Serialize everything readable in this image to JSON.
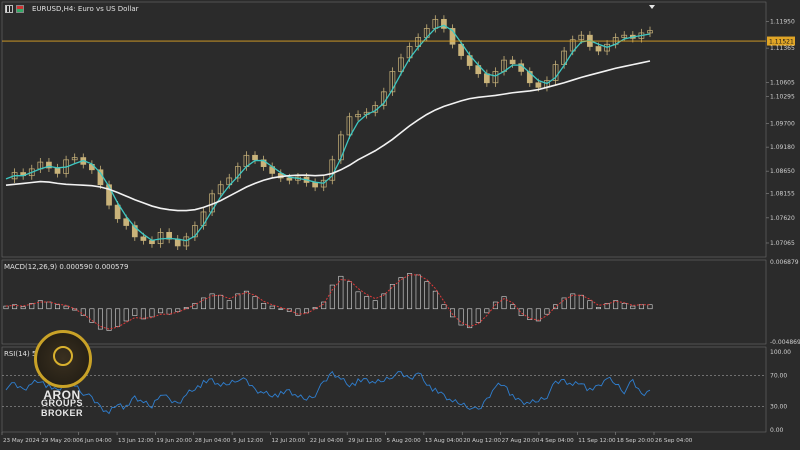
{
  "header": {
    "symbol_title": "EURUSD,H4: Euro vs US Dollar",
    "macd_title": "MACD(12,26,9) 0.000590 0.000579",
    "rsi_title": "RSI(14) 51.30"
  },
  "brand": {
    "line1": "ARON",
    "line2": "GROUPS",
    "line3": "BROKER"
  },
  "colors": {
    "background": "#2b2b2b",
    "candle": "#c9b37a",
    "fast_ma": "#3ec7c2",
    "slow_ma": "#f2f2f2",
    "price_line": "#e0a526",
    "macd_hist": "#d9d9d9",
    "macd_signal": "#e03a3a",
    "rsi_line": "#2f7fd0"
  },
  "chart_data": [
    {
      "type": "line",
      "title": "EURUSD,H4: Euro vs US Dollar",
      "current_price_label": "1.11521",
      "yticks": [
        "1.11950",
        "1.11365",
        "1.10605",
        "1.10295",
        "1.09700",
        "1.09180",
        "1.08650",
        "1.08155",
        "1.07620",
        "1.07065"
      ],
      "ylim": [
        1.068,
        1.1225
      ],
      "current_price": 1.11521,
      "xticks": [
        "23 May 2024",
        "29 May 20:00",
        "6 Jun 04:00",
        "13 Jun 12:00",
        "19 Jun 20:00",
        "28 Jun 04:00",
        "5 Jul 12:00",
        "12 Jul 20:00",
        "22 Jul 04:00",
        "29 Jul 12:00",
        "5 Aug 20:00",
        "13 Aug 04:00",
        "20 Aug 12:00",
        "27 Aug 20:00",
        "4 Sep 04:00",
        "11 Sep 12:00",
        "18 Sep 20:00",
        "26 Sep 04:00"
      ],
      "series": [
        {
          "values": [
            1.0848,
            1.0862,
            1.0855,
            1.087,
            1.0885,
            1.0872,
            1.086,
            1.089,
            1.0895,
            1.088,
            1.0868,
            1.0835,
            1.079,
            1.076,
            1.0745,
            1.072,
            1.0712,
            1.0705,
            1.073,
            1.0715,
            1.07,
            1.072,
            1.0745,
            1.0775,
            1.0815,
            1.0835,
            1.085,
            1.0875,
            1.09,
            1.089,
            1.0875,
            1.086,
            1.085,
            1.0845,
            1.0852,
            1.084,
            1.083,
            1.0845,
            1.089,
            1.0945,
            1.0985,
            1.099,
            1.0995,
            1.101,
            1.104,
            1.1085,
            1.1115,
            1.114,
            1.116,
            1.118,
            1.12,
            1.118,
            1.1145,
            1.112,
            1.1098,
            1.108,
            1.106,
            1.1085,
            1.111,
            1.1102,
            1.1085,
            1.106,
            1.105,
            1.1065,
            1.11,
            1.113,
            1.1155,
            1.1165,
            1.114,
            1.113,
            1.1145,
            1.116,
            1.1165,
            1.1158,
            1.117,
            1.1175
          ]
        },
        {
          "values": [
            1.0834,
            1.0836,
            1.0838,
            1.084,
            1.0842,
            1.0841,
            1.0838,
            1.0836,
            1.0835,
            1.0834,
            1.0833,
            1.083,
            1.0825,
            1.0818,
            1.081,
            1.0802,
            1.0795,
            1.0788,
            1.0783,
            1.078,
            1.0778,
            1.0778,
            1.078,
            1.0785,
            1.0792,
            1.08,
            1.081,
            1.082,
            1.083,
            1.0838,
            1.0845,
            1.085,
            1.0853,
            1.0855,
            1.0856,
            1.0856,
            1.0855,
            1.0856,
            1.086,
            1.0868,
            1.0878,
            1.089,
            1.09,
            1.091,
            1.0922,
            1.0935,
            1.095,
            1.0965,
            1.0978,
            1.099,
            1.1,
            1.1008,
            1.1014,
            1.102,
            1.1025,
            1.1028,
            1.103,
            1.1032,
            1.1035,
            1.1038,
            1.104,
            1.1042,
            1.1045,
            1.105,
            1.1055,
            1.106,
            1.1066,
            1.1072,
            1.1077,
            1.1082,
            1.1087,
            1.1092,
            1.1096,
            1.11,
            1.1104,
            1.1108
          ]
        }
      ]
    },
    {
      "type": "bar",
      "title": "MACD(12,26,9) 0.000590 0.000579",
      "yticks": [
        "0.006879",
        "-0.004869"
      ],
      "ylim": [
        -0.0049,
        0.0069
      ],
      "series": [
        {
          "values": [
            0.0004,
            0.0006,
            0.0003,
            0.0008,
            0.0012,
            0.001,
            0.0006,
            0.0004,
            -0.0002,
            -0.001,
            -0.002,
            -0.003,
            -0.0032,
            -0.0026,
            -0.0018,
            -0.001,
            -0.0015,
            -0.0012,
            -0.0006,
            -0.0008,
            -0.0004,
            0.0002,
            0.0008,
            0.0016,
            0.0022,
            0.002,
            0.0012,
            0.0022,
            0.0026,
            0.0018,
            0.0008,
            0.0004,
            0.0,
            -0.0004,
            -0.001,
            -0.0006,
            0.0002,
            0.001,
            0.0035,
            0.0048,
            0.004,
            0.0025,
            0.0018,
            0.0012,
            0.0022,
            0.0036,
            0.0046,
            0.0052,
            0.005,
            0.004,
            0.0026,
            0.0006,
            -0.0012,
            -0.0024,
            -0.0028,
            -0.002,
            -0.0006,
            0.001,
            0.0018,
            0.0006,
            -0.001,
            -0.0016,
            -0.0018,
            -0.0008,
            0.0006,
            0.0016,
            0.0022,
            0.002,
            0.0012,
            0.0002,
            0.0008,
            0.0012,
            0.0008,
            0.0004,
            0.0006,
            0.0006
          ]
        },
        {
          "values": [
            0.0004,
            0.0005,
            0.0004,
            0.0007,
            0.001,
            0.001,
            0.0007,
            0.0005,
            0.0,
            -0.0008,
            -0.0017,
            -0.0026,
            -0.003,
            -0.0027,
            -0.002,
            -0.0013,
            -0.0014,
            -0.0013,
            -0.0008,
            -0.0008,
            -0.0005,
            0.0,
            0.0006,
            0.0013,
            0.0019,
            0.002,
            0.0015,
            0.002,
            0.0024,
            0.002,
            0.0011,
            0.0006,
            0.0002,
            -0.0002,
            -0.0008,
            -0.0007,
            0.0,
            0.0007,
            0.0028,
            0.0043,
            0.0042,
            0.003,
            0.0021,
            0.0015,
            0.002,
            0.0032,
            0.0043,
            0.005,
            0.005,
            0.0043,
            0.003,
            0.0011,
            -0.0008,
            -0.002,
            -0.0026,
            -0.0022,
            -0.001,
            0.0006,
            0.0015,
            0.0009,
            -0.0006,
            -0.0014,
            -0.0017,
            -0.001,
            0.0003,
            0.0013,
            0.002,
            0.002,
            0.0014,
            0.0005,
            0.0007,
            0.0011,
            0.0009,
            0.0005,
            0.0006,
            0.0006
          ]
        }
      ]
    },
    {
      "type": "line",
      "title": "RSI(14) 51.30",
      "yticks": [
        "100.00",
        "70.00",
        "30.00",
        "0.00"
      ],
      "ylim": [
        0,
        100
      ],
      "levels": [
        70,
        30
      ],
      "series": [
        {
          "values": [
            55,
            58,
            52,
            60,
            64,
            55,
            50,
            62,
            58,
            48,
            40,
            30,
            22,
            35,
            28,
            42,
            35,
            30,
            48,
            38,
            34,
            46,
            54,
            60,
            64,
            56,
            60,
            66,
            62,
            52,
            48,
            45,
            46,
            50,
            42,
            40,
            46,
            60,
            74,
            66,
            58,
            62,
            64,
            60,
            64,
            70,
            72,
            66,
            74,
            60,
            50,
            44,
            36,
            34,
            30,
            24,
            40,
            56,
            60,
            42,
            36,
            34,
            38,
            44,
            60,
            64,
            58,
            62,
            50,
            56,
            66,
            60,
            50,
            62,
            46,
            51
          ]
        }
      ]
    }
  ]
}
